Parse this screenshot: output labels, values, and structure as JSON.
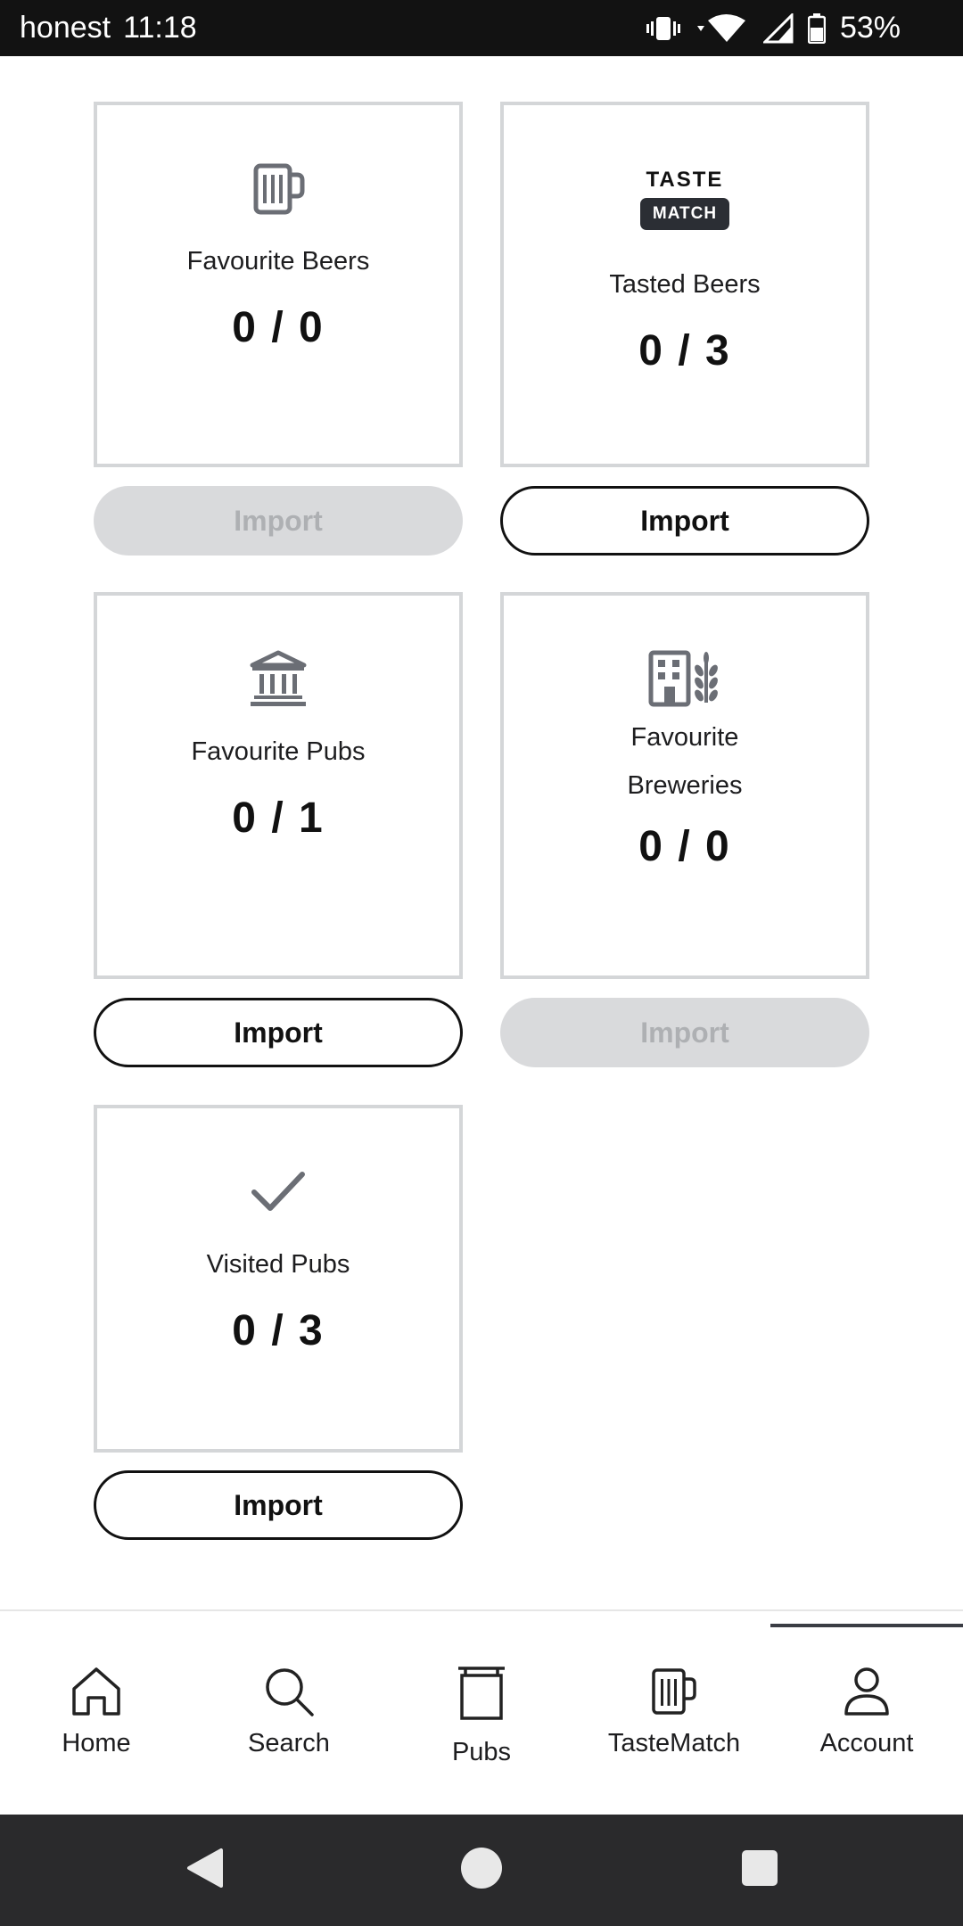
{
  "status_bar": {
    "carrier": "honest",
    "time": "11:18",
    "battery": "53%"
  },
  "cards": [
    {
      "label": "Favourite Beers",
      "count": "0 / 0",
      "icon": "beer-mug-icon",
      "import_label": "Import",
      "import_enabled": false
    },
    {
      "label": "Tasted Beers",
      "count": "0 / 3",
      "icon": "taste-match-logo",
      "logo_top": "TASTE",
      "logo_bottom": "MATCH",
      "import_label": "Import",
      "import_enabled": true
    },
    {
      "label": "Favourite Pubs",
      "count": "0 / 1",
      "icon": "pub-building-icon",
      "import_label": "Import",
      "import_enabled": true
    },
    {
      "label_line1": "Favourite",
      "label_line2": "Breweries",
      "count": "0 / 0",
      "icon": "brewery-icon",
      "import_label": "Import",
      "import_enabled": false
    },
    {
      "label": "Visited Pubs",
      "count": "0 / 3",
      "icon": "checkmark-icon",
      "import_label": "Import",
      "import_enabled": true
    }
  ],
  "bottom_nav": {
    "items": [
      {
        "label": "Home",
        "icon": "home-icon"
      },
      {
        "label": "Search",
        "icon": "search-icon"
      },
      {
        "label": "Pubs",
        "icon": "pub-sign-icon"
      },
      {
        "label": "TasteMatch",
        "icon": "beer-mug-icon"
      },
      {
        "label": "Account",
        "icon": "person-icon"
      }
    ],
    "active": "Account"
  },
  "colors": {
    "card_border": "#d4d6d8",
    "icon_gray": "#6b6e75",
    "disabled_bg": "#d9dadc",
    "disabled_text": "#aeb0b3",
    "status_bar_bg": "#121212",
    "system_nav_bg": "#2a2a2c"
  }
}
